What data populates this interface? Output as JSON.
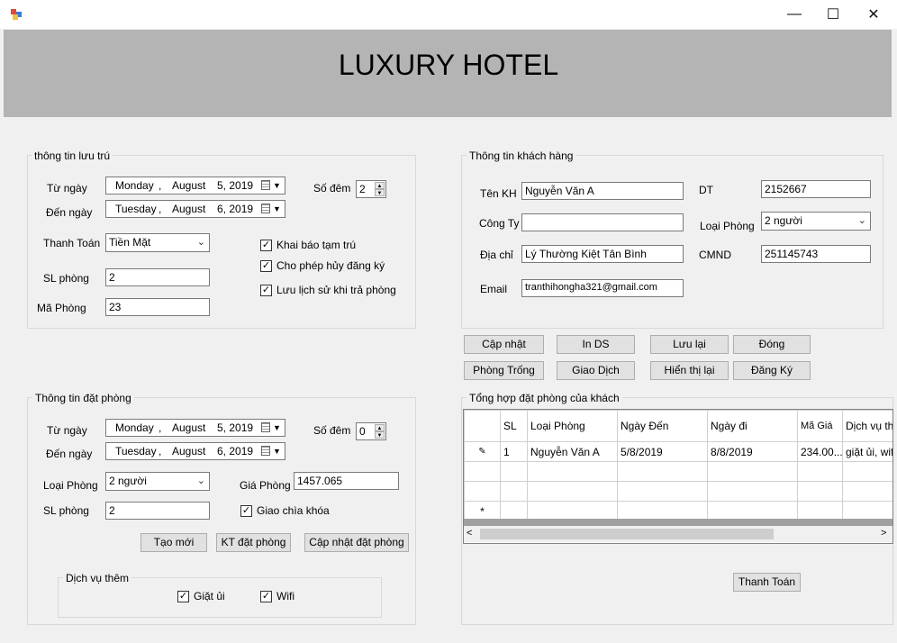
{
  "window": {
    "minimize_glyph": "—",
    "maximize_glyph": "☐",
    "close_glyph": "✕"
  },
  "banner": {
    "title": "LUXURY HOTEL"
  },
  "luu_tru": {
    "legend": "thông tin lưu trú",
    "from_label": "Từ ngày",
    "from_date": {
      "weekday": "Monday",
      "sep": ",",
      "month": "August",
      "day_year": "5, 2019"
    },
    "to_label": "Đến ngày",
    "to_date": {
      "weekday": "Tuesday",
      "sep": ",",
      "month": "August",
      "day_year": "6, 2019"
    },
    "nights_label": "Số đêm",
    "nights_value": "2",
    "payment_label": "Thanh Toán",
    "payment_value": "Tiền Mặt",
    "rooms_label": "SL phòng",
    "rooms_value": "2",
    "room_code_label": "Mã Phòng",
    "room_code_value": "23",
    "checks": [
      {
        "label": "Khai báo tạm trú",
        "checked": true
      },
      {
        "label": "Cho phép hủy đăng ký",
        "checked": true
      },
      {
        "label": "Lưu lịch sử khi trả phòng",
        "checked": true
      }
    ]
  },
  "khach_hang": {
    "legend": "Thông tin khách hàng",
    "name_label": "Tên KH",
    "name_value": "Nguyễn Văn A",
    "company_label": "Công Ty",
    "company_value": "",
    "address_label": "Địa chỉ",
    "address_value": "Lý Thường Kiệt Tân Bình",
    "email_label": "Email",
    "email_value": "tranthihongha321@gmail.com",
    "phone_label": "DT",
    "phone_value": "2152667",
    "room_type_label": "Loại Phòng",
    "room_type_value": "2 người",
    "id_label": "CMND",
    "id_value": "251145743"
  },
  "actions": {
    "cap_nhat": "Cập nhật",
    "in_ds": "In DS",
    "luu_lai": "Lưu lại",
    "dong": "Đóng",
    "phong_trong": "Phòng Trống",
    "giao_dich": "Giao Dịch",
    "hien_thi_lai": "Hiển thị lại",
    "dang_ky": "Đăng Ký"
  },
  "dat_phong": {
    "legend": "Thông tin đặt phòng",
    "from_label": "Từ ngày",
    "from_date": {
      "weekday": "Monday",
      "sep": ",",
      "month": "August",
      "day_year": "5, 2019"
    },
    "to_label": "Đến ngày",
    "to_date": {
      "weekday": "Tuesday",
      "sep": ",",
      "month": "August",
      "day_year": "6, 2019"
    },
    "nights_label": "Số đêm",
    "nights_value": "0",
    "room_type_label": "Loại Phòng",
    "room_type_value": "2 người",
    "price_label": "Giá Phòng",
    "price_value": "1457.065",
    "rooms_label": "SL phòng",
    "rooms_value": "2",
    "key_check_label": "Giao chìa khóa",
    "key_check_checked": true,
    "btn_new": "Tạo mới",
    "btn_check": "KT đặt phòng",
    "btn_update": "Cập nhật đặt phòng",
    "services_legend": "Dịch vụ thêm",
    "laundry_label": "Giặt ủi",
    "laundry_checked": true,
    "wifi_label": "Wifi",
    "wifi_checked": true
  },
  "tong_hop": {
    "legend": "Tổng hợp đặt phòng của khách",
    "columns": [
      "SL",
      "Loại Phòng",
      "Ngày Đến",
      "Ngày đi",
      "Mã Giá",
      "Dịch vụ th"
    ],
    "rows": [
      [
        "1",
        "Nguyễn Văn A",
        "5/8/2019",
        "8/8/2019",
        "234.00...",
        "giặt ủi, wifi"
      ]
    ],
    "edit_marker": "✎",
    "new_marker": "*",
    "scroll_left": "<",
    "scroll_right": ">",
    "btn_pay": "Thanh Toán"
  }
}
